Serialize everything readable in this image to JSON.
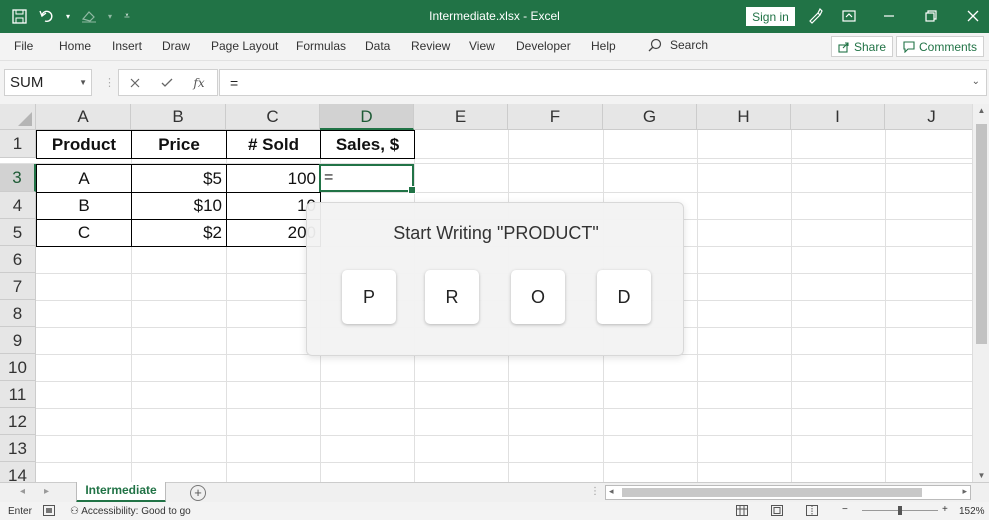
{
  "window": {
    "title": "Intermediate.xlsx  -  Excel",
    "sign_in": "Sign in"
  },
  "ribbon": {
    "tabs": [
      "File",
      "Home",
      "Insert",
      "Draw",
      "Page Layout",
      "Formulas",
      "Data",
      "Review",
      "View",
      "Developer",
      "Help"
    ],
    "search_label": "Search",
    "share_label": "Share",
    "comments_label": "Comments"
  },
  "formula_bar": {
    "name_box": "SUM",
    "formula": "="
  },
  "sheet": {
    "columns": [
      "A",
      "B",
      "C",
      "D",
      "E",
      "F",
      "G",
      "H",
      "I",
      "J"
    ],
    "rows": [
      "1",
      "3",
      "4",
      "5",
      "6",
      "7",
      "8",
      "9",
      "10",
      "11",
      "12",
      "13",
      "14"
    ],
    "header_cells": [
      "Product",
      "Price",
      "# Sold",
      "Sales, $"
    ],
    "data_rows": [
      {
        "product": "A",
        "price": "$5",
        "sold": "100"
      },
      {
        "product": "B",
        "price": "$10",
        "sold": "10"
      },
      {
        "product": "C",
        "price": "$2",
        "sold": "200"
      }
    ],
    "active_cell_value": "="
  },
  "popup": {
    "title": "Start Writing \"PRODUCT\"",
    "keys": [
      "P",
      "R",
      "O",
      "D"
    ]
  },
  "sheet_tabs": {
    "active": "Intermediate",
    "add_label": "+"
  },
  "status": {
    "mode": "Enter",
    "accessibility": "Accessibility: Good to go",
    "zoom": "152%"
  },
  "colors": {
    "accent": "#217346",
    "popup_bg": "#f2f2f2"
  }
}
